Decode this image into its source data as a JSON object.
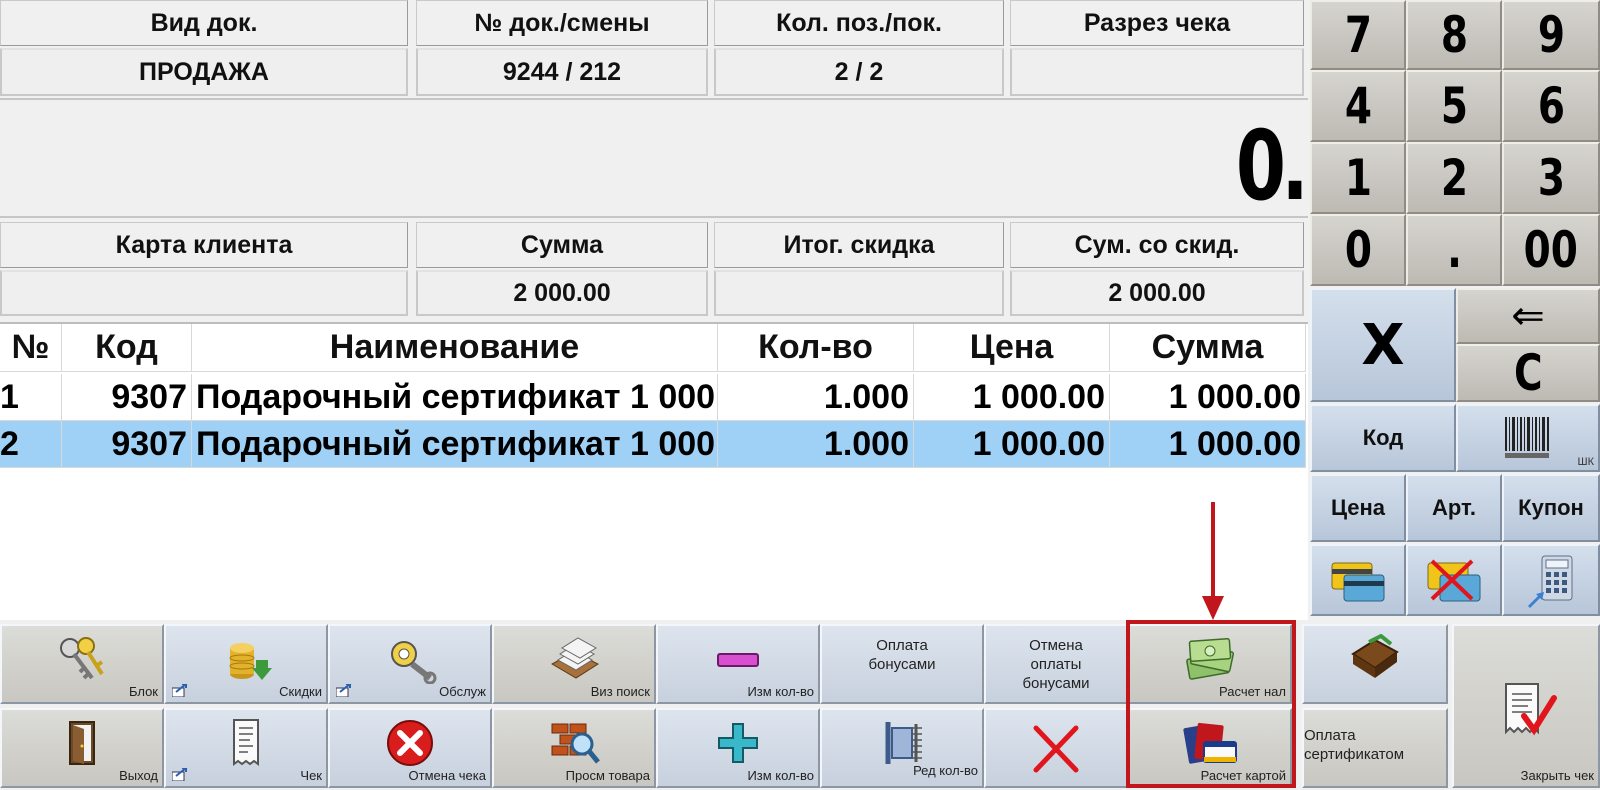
{
  "header": {
    "doc_type": {
      "label": "Вид док.",
      "value": "ПРОДАЖА"
    },
    "doc_shift": {
      "label": "№ док./смены",
      "value": "9244 / 212"
    },
    "pos_count": {
      "label": "Кол. поз./пок.",
      "value": "2 / 2"
    },
    "receipt_section": {
      "label": "Разрез чека",
      "value": ""
    }
  },
  "display": {
    "value": "0."
  },
  "totals": {
    "client_card": {
      "label": "Карта клиента",
      "value": ""
    },
    "sum": {
      "label": "Сумма",
      "value": "2 000.00"
    },
    "total_discount": {
      "label": "Итог. скидка",
      "value": ""
    },
    "sum_discounted": {
      "label": "Сум. со скид.",
      "value": "2 000.00"
    }
  },
  "table": {
    "columns": [
      "№",
      "Код",
      "Наименование",
      "Кол-во",
      "Цена",
      "Сумма"
    ],
    "rows": [
      {
        "no": "1",
        "code": "9307",
        "name": "Подарочный сертификат 1 000",
        "qty": "1.000",
        "price": "1 000.00",
        "sum": "1 000.00"
      },
      {
        "no": "2",
        "code": "9307",
        "name": "Подарочный сертификат 1 000",
        "qty": "1.000",
        "price": "1 000.00",
        "sum": "1 000.00"
      }
    ],
    "selected_row": 2
  },
  "keypad": {
    "digits": [
      "7",
      "8",
      "9",
      "4",
      "5",
      "6",
      "1",
      "2",
      "3",
      "0",
      ".",
      "00"
    ],
    "multiply": "X",
    "backspace": "⇐",
    "clear": "C",
    "code": "Код",
    "barcode_caption": "ШК",
    "price": "Цена",
    "article": "Арт.",
    "coupon": "Купон"
  },
  "toolbar": {
    "block": "Блок",
    "discounts": "Скидки",
    "service": "Обслуж",
    "visual_search": "Виз поиск",
    "qty_minus": "Изм кол-во",
    "pay_bonus": "Оплата бонусами",
    "cancel_bonus": "Отмена оплаты бонусами",
    "cash": "Расчет нал",
    "exit": "Выход",
    "receipt": "Чек",
    "cancel_receipt": "Отмена чека",
    "view_goods": "Просм товара",
    "qty_plus": "Изм кол-во",
    "edit_qty": "Ред кол-во",
    "card": "Расчет картой",
    "pay_certificate": "Оплата сертификатом",
    "close_receipt": "Закрыть чек"
  },
  "colors": {
    "selected_row": "#9fd0f6",
    "highlight": "#c0161c"
  }
}
